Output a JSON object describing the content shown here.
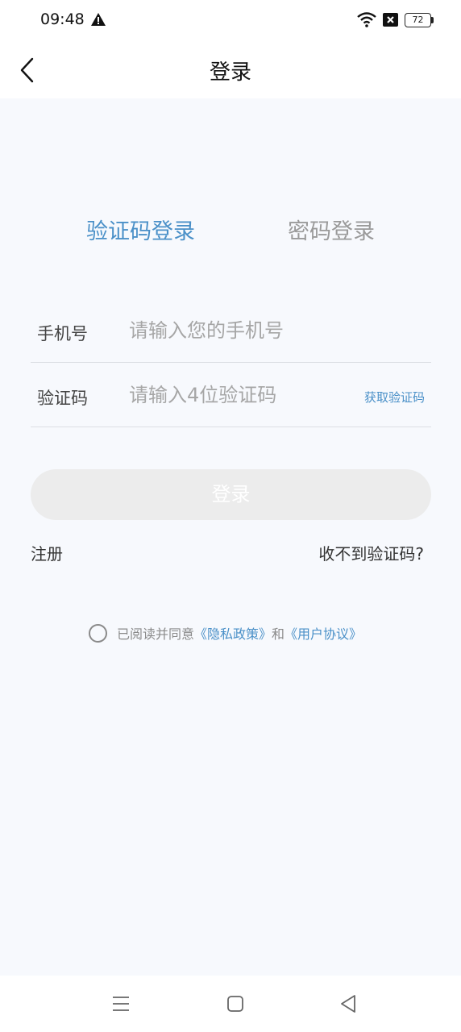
{
  "status_bar": {
    "time": "09:48",
    "battery": "72",
    "icons": [
      "warning-icon",
      "wifi-icon",
      "no-sim-icon",
      "battery-icon"
    ]
  },
  "header": {
    "title": "登录",
    "back_icon": "chevron-left-icon"
  },
  "tabs": [
    {
      "label": "验证码登录",
      "active": true
    },
    {
      "label": "密码登录",
      "active": false
    }
  ],
  "form": {
    "phone": {
      "label": "手机号",
      "placeholder": "请输入您的手机号",
      "value": ""
    },
    "code": {
      "label": "验证码",
      "placeholder": "请输入4位验证码",
      "value": "",
      "get_code_label": "获取验证码"
    },
    "submit_label": "登录"
  },
  "links": {
    "register": "注册",
    "no_code": "收不到验证码?"
  },
  "agreement": {
    "prefix": "已阅读并同意",
    "privacy": "《隐私政策》",
    "and": "和",
    "terms": "《用户协议》",
    "checked": false
  },
  "colors": {
    "accent": "#4a90c8",
    "background": "#f7f9fd",
    "button_disabled": "#ececec"
  },
  "system_nav": {
    "icons": [
      "menu-icon",
      "home-icon",
      "back-icon"
    ]
  }
}
